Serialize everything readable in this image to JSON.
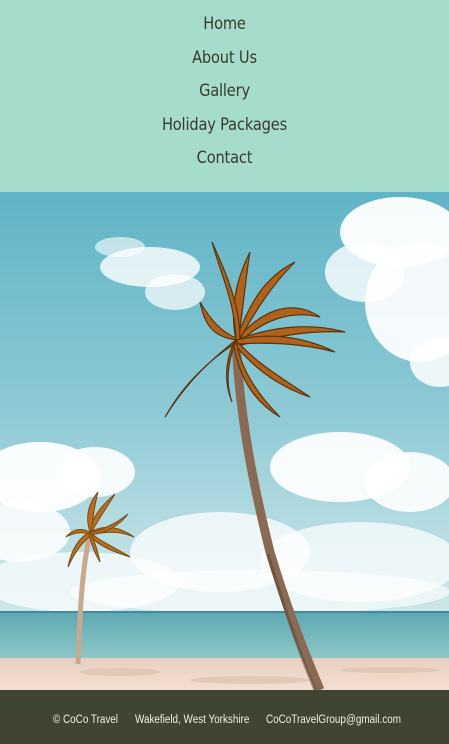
{
  "nav": {
    "items": [
      {
        "label": "Home"
      },
      {
        "label": "About Us"
      },
      {
        "label": "Gallery"
      },
      {
        "label": "Holiday Packages"
      },
      {
        "label": "Contact"
      }
    ]
  },
  "hero": {
    "image": "palm-trees-beach-photo"
  },
  "footer": {
    "copyright": "© CoCo Travel",
    "location": "Wakefield, West Yorkshire",
    "email": "CoCoTravelGroup@gmail.com"
  },
  "colors": {
    "nav_bg": "#a6dccc",
    "footer_bg": "#3f4531",
    "nav_text": "#3a3a2c",
    "footer_text": "#f1efe4"
  }
}
